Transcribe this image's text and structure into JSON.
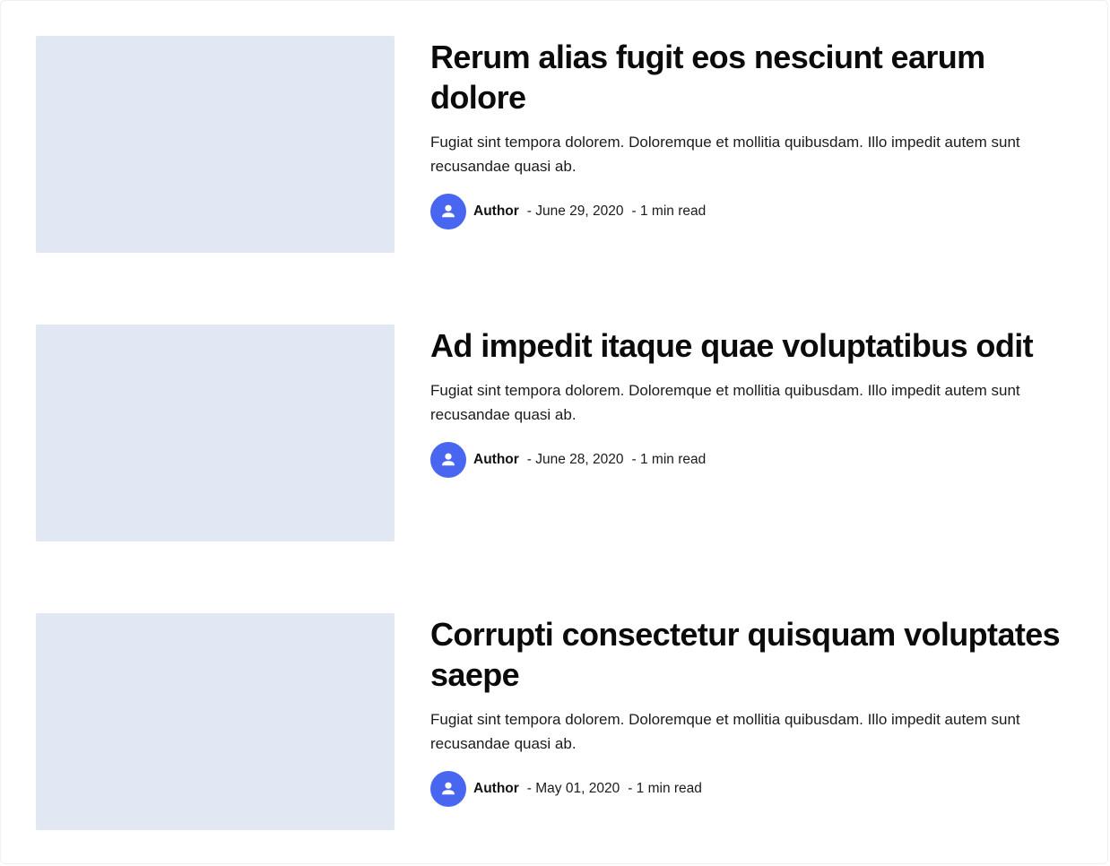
{
  "colors": {
    "avatar_bg": "#4866f0",
    "thumbnail_bg": "#e1e8f4"
  },
  "posts": [
    {
      "title": "Rerum alias fugit eos nesciunt earum dolore",
      "excerpt": "Fugiat sint tempora dolorem. Doloremque et mollitia quibusdam. Illo impedit autem sunt recusandae quasi ab.",
      "author": "Author",
      "date": "- June 29, 2020",
      "read_time": "- 1 min read",
      "avatar_icon": "user-icon"
    },
    {
      "title": "Ad impedit itaque quae voluptatibus odit",
      "excerpt": "Fugiat sint tempora dolorem. Doloremque et mollitia quibusdam. Illo impedit autem sunt recusandae quasi ab.",
      "author": "Author",
      "date": "- June 28, 2020",
      "read_time": "- 1 min read",
      "avatar_icon": "user-icon"
    },
    {
      "title": "Corrupti consectetur quisquam voluptates saepe",
      "excerpt": "Fugiat sint tempora dolorem. Doloremque et mollitia quibusdam. Illo impedit autem sunt recusandae quasi ab.",
      "author": "Author",
      "date": "- May 01, 2020",
      "read_time": "- 1 min read",
      "avatar_icon": "user-icon"
    }
  ]
}
